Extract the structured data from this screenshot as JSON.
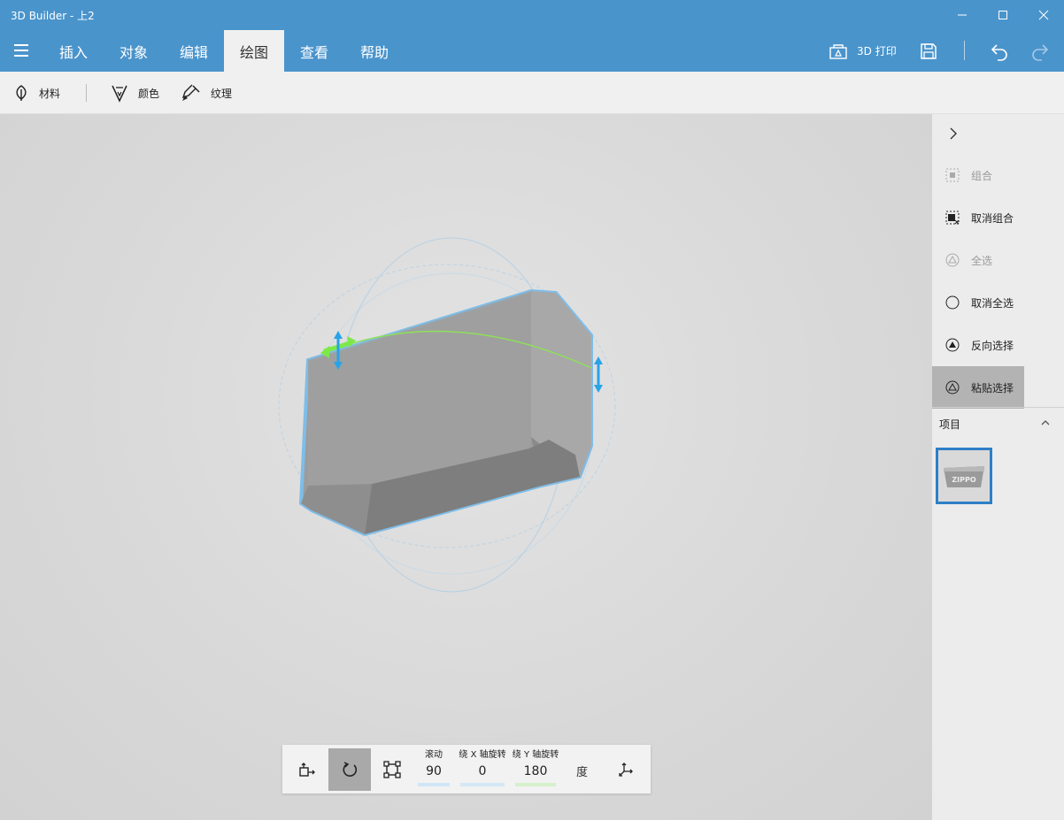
{
  "window": {
    "title": "3D Builder - 上2",
    "controls": [
      "minimize",
      "maximize",
      "close"
    ]
  },
  "menu": {
    "tabs": [
      {
        "label": "插入"
      },
      {
        "label": "对象"
      },
      {
        "label": "编辑"
      },
      {
        "label": "绘图",
        "active": true
      },
      {
        "label": "查看"
      },
      {
        "label": "帮助"
      }
    ],
    "print_label": "3D 打印",
    "icons": [
      "hamburger-icon",
      "print-3d-icon",
      "save-icon",
      "undo-icon",
      "redo-icon"
    ]
  },
  "toolbar": {
    "material": "材料",
    "color": "颜色",
    "texture": "纹理"
  },
  "right_panel": {
    "actions": [
      {
        "label": "组合",
        "enabled": false
      },
      {
        "label": "取消组合",
        "enabled": true
      },
      {
        "label": "全选",
        "enabled": false
      },
      {
        "label": "取消全选",
        "enabled": true
      },
      {
        "label": "反向选择",
        "enabled": true
      },
      {
        "label": "粘贴选择",
        "enabled": true,
        "selected": true
      }
    ],
    "items_header": "项目",
    "thumbnail_text": "ZIPPO"
  },
  "transform_bar": {
    "roll_label": "滚动",
    "roll_value": "90",
    "rotx_label": "绕 X 轴旋转",
    "rotx_value": "0",
    "roty_label": "绕 Y 轴旋转",
    "roty_value": "180",
    "unit": "度"
  },
  "colors": {
    "accent": "#4a94cc",
    "selection": "#2e7fc6",
    "handle_blue": "#29a3e8",
    "handle_green": "#7ee84a"
  }
}
